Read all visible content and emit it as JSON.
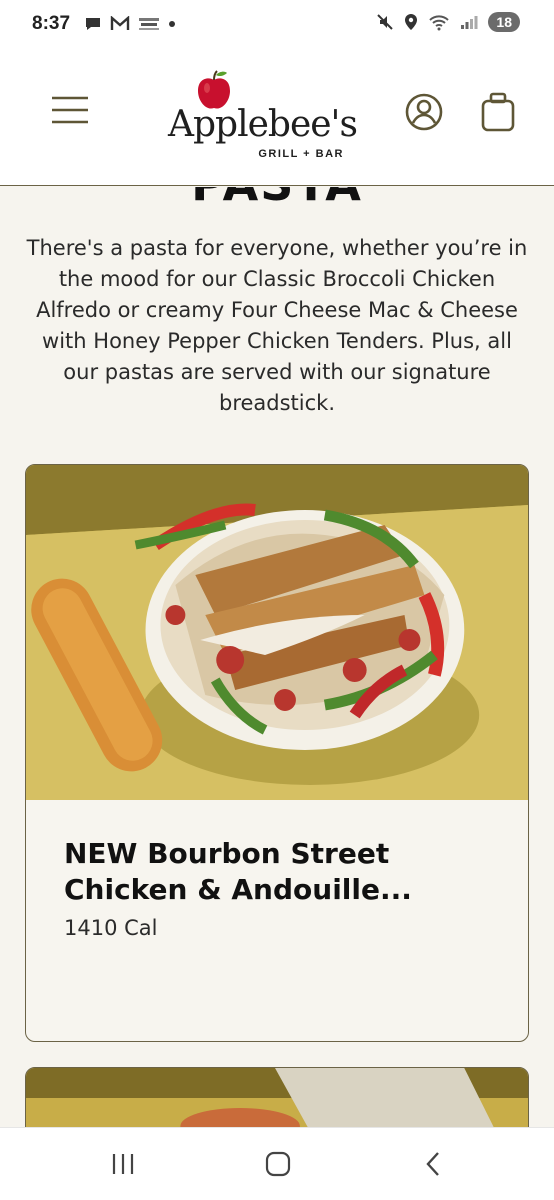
{
  "status": {
    "time": "8:37",
    "battery": "18"
  },
  "header": {
    "logo_main": "Applebee's",
    "logo_sub": "GRILL + BAR"
  },
  "section": {
    "title": "PASTA",
    "description": "There's a pasta for everyone, whether you’re in the mood for our Classic Broccoli Chicken Alfredo or creamy Four Cheese Mac & Cheese with Honey Pepper Chicken Tenders. Plus, all our pastas are served with our signature breadstick."
  },
  "items": [
    {
      "title": "NEW Bourbon Street Chicken & Andouille...",
      "calories": "1410 Cal"
    }
  ],
  "colors": {
    "accent_border": "#6b6346",
    "background": "#f6f4ee",
    "brand_red": "#c8102e"
  }
}
